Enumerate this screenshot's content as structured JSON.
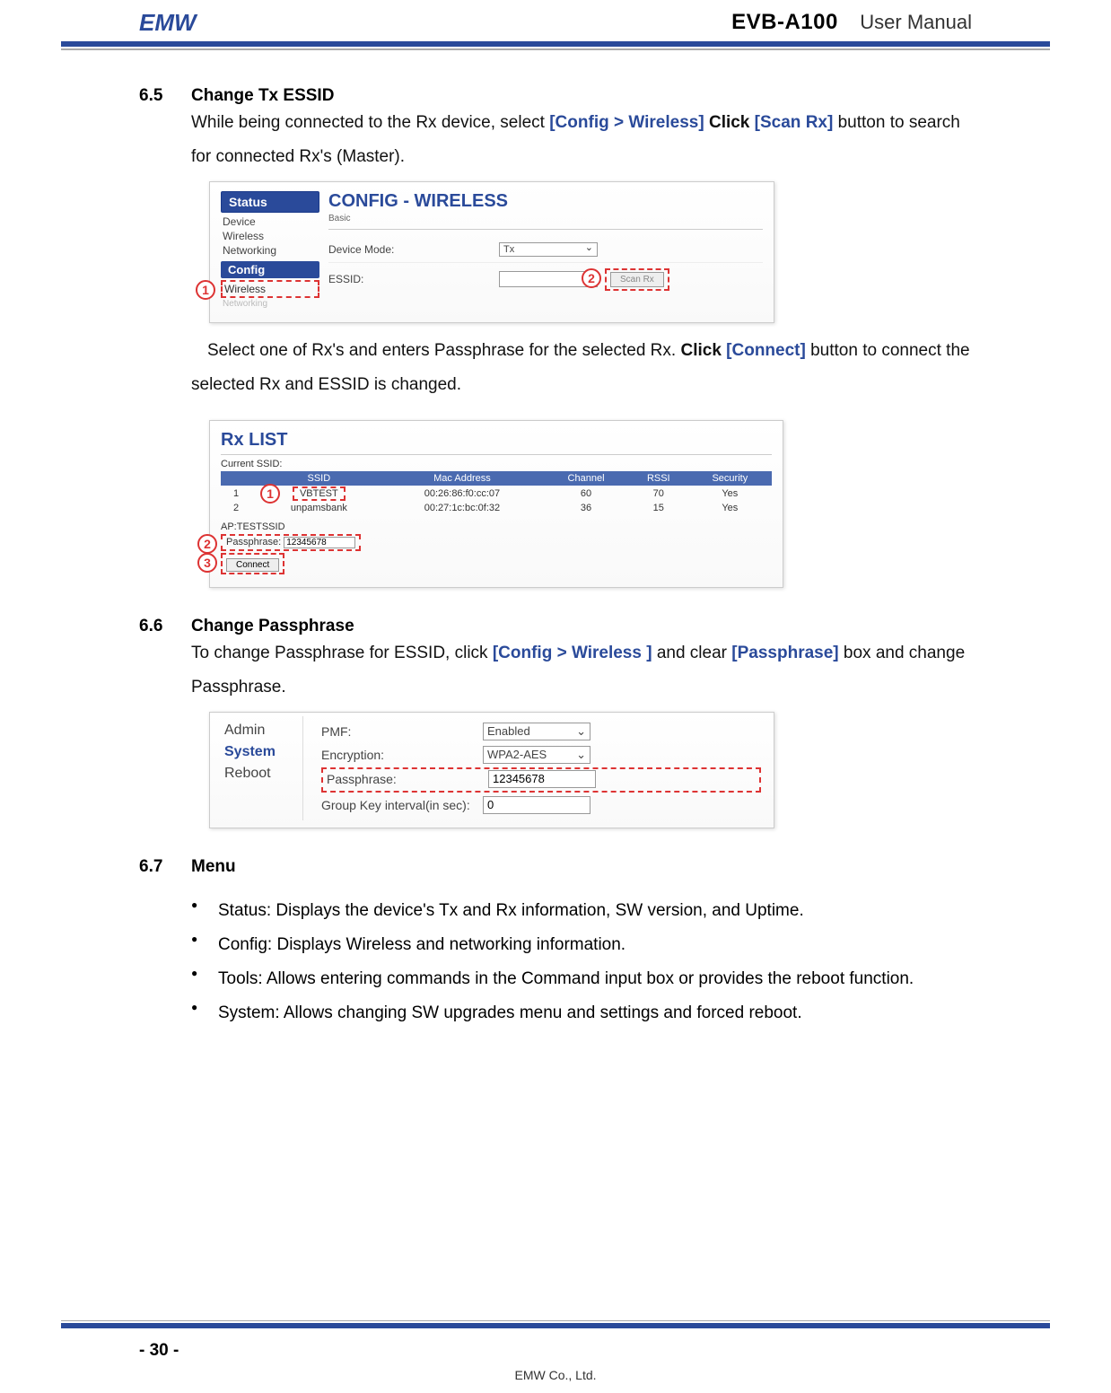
{
  "header": {
    "product": "EVB-A100",
    "doc_type": "User  Manual"
  },
  "s65": {
    "num": "6.5",
    "title": "Change Tx ESSID",
    "p1_a": "While being connected to the Rx device, select ",
    "p1_b": "[Config > Wireless]",
    "p1_c": " Click ",
    "p1_d": "[Scan Rx]",
    "p1_e": " button to search for connected Rx's (Master).",
    "p2_a": "Select one of Rx's and enters Passphrase for the selected Rx. ",
    "p2_b": "Click ",
    "p2_c": "[Connect]",
    "p2_d": " button to connect the selected Rx and ESSID is changed."
  },
  "ss1": {
    "nav_status": "Status",
    "nav_device": "Device",
    "nav_wireless": "Wireless",
    "nav_networking": "Networking",
    "nav_config": "Config",
    "nav_wireless2": "Wireless",
    "nav_networking2": "Networking",
    "title": "CONFIG - WIRELESS",
    "sub": "Basic",
    "devmode_lbl": "Device Mode:",
    "devmode_val": "Tx",
    "essid_lbl": "ESSID:",
    "scan_btn": "Scan Rx",
    "c1": "1",
    "c2": "2"
  },
  "ss2": {
    "title": "Rx LIST",
    "cur_ssid_lbl": "Current SSID:",
    "th_ssid": "SSID",
    "th_mac": "Mac Address",
    "th_ch": "Channel",
    "th_rssi": "RSSI",
    "th_sec": "Security",
    "rows": [
      {
        "idx": "1",
        "ssid": "VBTEST",
        "mac": "00:26:86:f0:cc:07",
        "ch": "60",
        "rssi": "70",
        "sec": "Yes"
      },
      {
        "idx": "2",
        "ssid": "unpamsbank",
        "mac": "00:27:1c:bc:0f:32",
        "ch": "36",
        "rssi": "15",
        "sec": "Yes"
      }
    ],
    "ap_label": "AP:TESTSSID",
    "pass_label": "Passphrase:",
    "pass_val": "12345678",
    "connect": "Connect",
    "c1": "1",
    "c2": "2",
    "c3": "3"
  },
  "s66": {
    "num": "6.6",
    "title": "Change Passphrase",
    "p1_a": "To change Passphrase for ESSID, click ",
    "p1_b": "[Config > Wireless ]",
    "p1_c": " and clear ",
    "p1_d": "[Passphrase]",
    "p1_e": " box and change Passphrase."
  },
  "ss3": {
    "nav_admin": "Admin",
    "nav_system": "System",
    "nav_reboot": "Reboot",
    "pmf_lbl": "PMF:",
    "pmf_val": "Enabled",
    "enc_lbl": "Encryption:",
    "enc_val": "WPA2-AES",
    "pass_lbl": "Passphrase:",
    "pass_val": "12345678",
    "gki_lbl": "Group Key interval(in sec):",
    "gki_val": "0"
  },
  "s67": {
    "num": "6.7",
    "title": "Menu",
    "items": [
      "Status: Displays the device's Tx and Rx information, SW version, and Uptime.",
      "Config: Displays Wireless and networking information.",
      "Tools: Allows entering commands in the Command input box or provides the reboot function.",
      "System: Allows changing SW upgrades menu and settings and forced reboot."
    ]
  },
  "footer": {
    "page": "- 30 -",
    "company": "EMW Co., Ltd."
  }
}
